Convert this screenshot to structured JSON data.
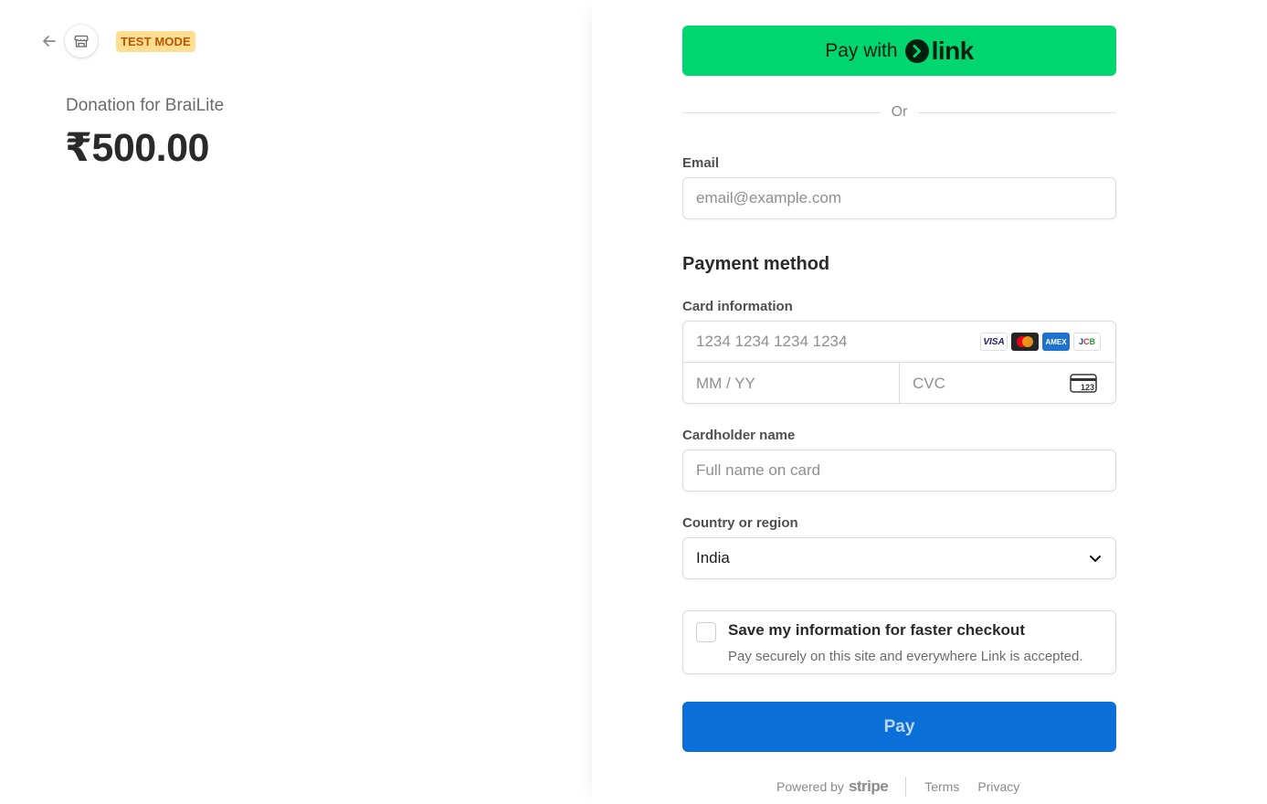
{
  "merchant": {
    "test_mode_badge": "TEST MODE",
    "product_name": "Donation for BraiLite",
    "amount": "₹500.00"
  },
  "link_button": {
    "prefix": "Pay with",
    "brand": "link"
  },
  "divider_text": "Or",
  "email": {
    "label": "Email",
    "placeholder": "email@example.com"
  },
  "payment_method": {
    "title": "Payment method",
    "card_label": "Card information",
    "card_number_placeholder": "1234 1234 1234 1234",
    "expiry_placeholder": "MM / YY",
    "cvc_placeholder": "CVC",
    "card_brands": [
      "VISA",
      "Mastercard",
      "AMEX",
      "JCB"
    ],
    "cvc_icon_text": "123"
  },
  "cardholder": {
    "label": "Cardholder name",
    "placeholder": "Full name on card"
  },
  "country": {
    "label": "Country or region",
    "value": "India"
  },
  "save_info": {
    "title": "Save my information for faster checkout",
    "subtitle": "Pay securely on this site and everywhere Link is accepted."
  },
  "pay_button": "Pay",
  "footer": {
    "powered_by": "Powered by",
    "stripe": "stripe",
    "terms": "Terms",
    "privacy": "Privacy"
  },
  "colors": {
    "link_green": "#00d66f",
    "pay_blue": "#0a6fd8",
    "badge_bg": "#ffde92",
    "badge_text": "#bb5504"
  }
}
